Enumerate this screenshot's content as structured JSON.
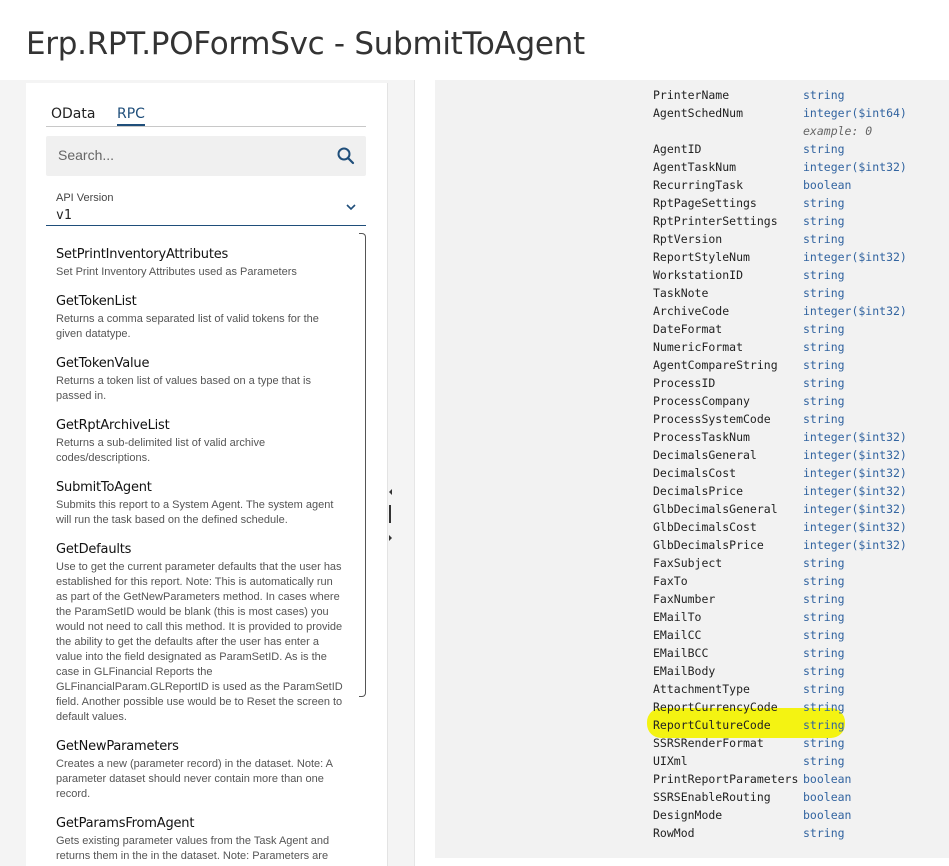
{
  "page": {
    "title": "Erp.RPT.POFormSvc - SubmitToAgent"
  },
  "tabs": [
    {
      "label": "OData"
    },
    {
      "label": "RPC"
    }
  ],
  "search": {
    "placeholder": "Search...",
    "icon": "search-icon"
  },
  "api_version": {
    "label": "API Version",
    "value": "v1"
  },
  "methods": [
    {
      "name": "SetPrintInventoryAttributes",
      "desc": "Set Print Inventory Attributes used as Parameters"
    },
    {
      "name": "GetTokenList",
      "desc": "Returns a comma separated list of valid tokens for the given datatype."
    },
    {
      "name": "GetTokenValue",
      "desc": "Returns a token list of values based on a type that is passed in."
    },
    {
      "name": "GetRptArchiveList",
      "desc": "Returns a sub-delimited list of valid archive codes/descriptions."
    },
    {
      "name": "SubmitToAgent",
      "desc": "Submits this report to a System Agent. The system agent will run the task based on the defined schedule."
    },
    {
      "name": "GetDefaults",
      "desc": "Use to get the current parameter defaults that the user has established for this report. Note: This is automatically run as part of the GetNewParameters method. In cases where the ParamSetID would be blank (this is most cases) you would not need to call this method. It is provided to provide the ability to get the defaults after the user has enter a value into the field designated as ParamSetID. As is the case in GLFinancial Reports the GLFinancialParam.GLReportID is used as the ParamSetID field. Another possible use would be to Reset the screen to default values."
    },
    {
      "name": "GetNewParameters",
      "desc": "Creates a new (parameter record) in the dataset. Note: A parameter dataset should never contain more than one record."
    },
    {
      "name": "GetParamsFromAgent",
      "desc": "Gets existing parameter values from the Task Agent and returns them in the in the dataset. Note: Parameters are"
    }
  ],
  "schema_fields": [
    {
      "name": "PrinterName",
      "type": "string"
    },
    {
      "name": "AgentSchedNum",
      "type": "integer($int64)",
      "example": "example: 0"
    },
    {
      "name": "AgentID",
      "type": "string"
    },
    {
      "name": "AgentTaskNum",
      "type": "integer($int32)"
    },
    {
      "name": "RecurringTask",
      "type": "boolean"
    },
    {
      "name": "RptPageSettings",
      "type": "string"
    },
    {
      "name": "RptPrinterSettings",
      "type": "string"
    },
    {
      "name": "RptVersion",
      "type": "string"
    },
    {
      "name": "ReportStyleNum",
      "type": "integer($int32)"
    },
    {
      "name": "WorkstationID",
      "type": "string"
    },
    {
      "name": "TaskNote",
      "type": "string"
    },
    {
      "name": "ArchiveCode",
      "type": "integer($int32)"
    },
    {
      "name": "DateFormat",
      "type": "string"
    },
    {
      "name": "NumericFormat",
      "type": "string"
    },
    {
      "name": "AgentCompareString",
      "type": "string"
    },
    {
      "name": "ProcessID",
      "type": "string"
    },
    {
      "name": "ProcessCompany",
      "type": "string"
    },
    {
      "name": "ProcessSystemCode",
      "type": "string"
    },
    {
      "name": "ProcessTaskNum",
      "type": "integer($int32)"
    },
    {
      "name": "DecimalsGeneral",
      "type": "integer($int32)"
    },
    {
      "name": "DecimalsCost",
      "type": "integer($int32)"
    },
    {
      "name": "DecimalsPrice",
      "type": "integer($int32)"
    },
    {
      "name": "GlbDecimalsGeneral",
      "type": "integer($int32)"
    },
    {
      "name": "GlbDecimalsCost",
      "type": "integer($int32)"
    },
    {
      "name": "GlbDecimalsPrice",
      "type": "integer($int32)"
    },
    {
      "name": "FaxSubject",
      "type": "string"
    },
    {
      "name": "FaxTo",
      "type": "string"
    },
    {
      "name": "FaxNumber",
      "type": "string"
    },
    {
      "name": "EMailTo",
      "type": "string"
    },
    {
      "name": "EMailCC",
      "type": "string"
    },
    {
      "name": "EMailBCC",
      "type": "string"
    },
    {
      "name": "EMailBody",
      "type": "string"
    },
    {
      "name": "AttachmentType",
      "type": "string"
    },
    {
      "name": "ReportCurrencyCode",
      "type": "string"
    },
    {
      "name": "ReportCultureCode",
      "type": "string",
      "highlighted": true
    },
    {
      "name": "SSRSRenderFormat",
      "type": "string"
    },
    {
      "name": "UIXml",
      "type": "string"
    },
    {
      "name": "PrintReportParameters",
      "type": "boolean"
    },
    {
      "name": "SSRSEnableRouting",
      "type": "boolean"
    },
    {
      "name": "DesignMode",
      "type": "boolean"
    },
    {
      "name": "RowMod",
      "type": "string"
    }
  ],
  "colors": {
    "accent": "#1f4e7a",
    "type_text": "#3264a0",
    "highlight": "#f4f312"
  }
}
